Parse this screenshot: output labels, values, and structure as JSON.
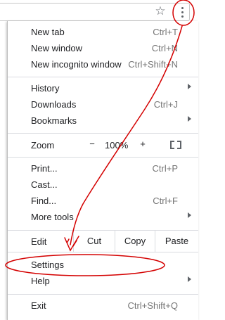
{
  "toolbar": {
    "bookmark_icon": "star-outline-icon",
    "menu_icon": "three-dot-menu-icon"
  },
  "menu": {
    "new_tab": {
      "label": "New tab",
      "shortcut": "Ctrl+T"
    },
    "new_window": {
      "label": "New window",
      "shortcut": "Ctrl+N"
    },
    "new_incognito": {
      "label": "New incognito window",
      "shortcut": "Ctrl+Shift+N"
    },
    "history": {
      "label": "History"
    },
    "downloads": {
      "label": "Downloads",
      "shortcut": "Ctrl+J"
    },
    "bookmarks": {
      "label": "Bookmarks"
    },
    "zoom": {
      "label": "Zoom",
      "minus": "−",
      "value": "100%",
      "plus": "+"
    },
    "print": {
      "label": "Print...",
      "shortcut": "Ctrl+P"
    },
    "cast": {
      "label": "Cast..."
    },
    "find": {
      "label": "Find...",
      "shortcut": "Ctrl+F"
    },
    "more_tools": {
      "label": "More tools"
    },
    "edit": {
      "label": "Edit",
      "cut": "Cut",
      "copy": "Copy",
      "paste": "Paste"
    },
    "settings": {
      "label": "Settings"
    },
    "help": {
      "label": "Help"
    },
    "exit": {
      "label": "Exit",
      "shortcut": "Ctrl+Shift+Q"
    }
  },
  "annotation": {
    "color": "#d40000"
  }
}
